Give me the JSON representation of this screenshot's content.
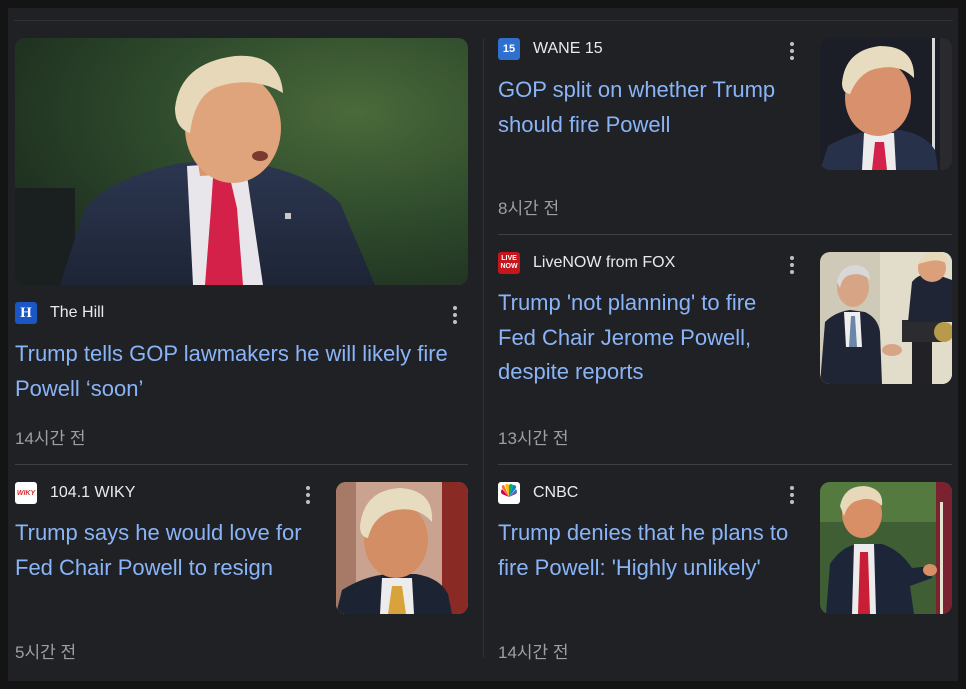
{
  "articles": [
    {
      "source": "The Hill",
      "logo_text": "H",
      "headline": "Trump tells GOP lawmakers he will likely fire Powell ‘soon’",
      "time": "14시간 전"
    },
    {
      "source": "WANE 15",
      "logo_text": "15",
      "headline": "GOP split on whether Trump should fire Powell",
      "time": "8시간 전"
    },
    {
      "source": "LiveNOW from FOX",
      "logo_text": "LIVE NOW",
      "headline": "Trump 'not planning' to fire Fed Chair Jerome Powell, despite reports",
      "time": "13시간 전"
    },
    {
      "source": "104.1 WIKY",
      "logo_text": "WIKY",
      "headline": "Trump says he would love for Fed Chair Powell to resign",
      "time": "5시간 전"
    },
    {
      "source": "CNBC",
      "logo_text": "",
      "headline": "Trump denies that he plans to fire Powell: 'Highly unlikely'",
      "time": "14시간 전"
    }
  ],
  "colors": {
    "headline": "#8ab4f8",
    "source": "#e8eaed",
    "time": "#9aa0a6",
    "background": "#202124",
    "the_hill_logo": "#1a56c4",
    "wane_logo": "#2f6fce",
    "fox_logo": "#c4161c",
    "wiky_logo": "#d32f2f"
  }
}
